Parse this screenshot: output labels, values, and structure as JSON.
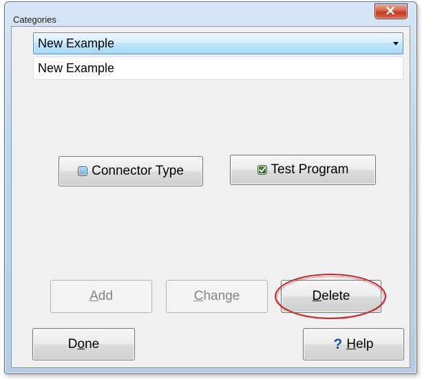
{
  "window": {
    "title": "Categories"
  },
  "category_select": {
    "value": "New Example"
  },
  "name_field": {
    "value": "New Example"
  },
  "options": [
    {
      "label": "Connector Type",
      "checked": false
    },
    {
      "label": "Test Program",
      "checked": true
    }
  ],
  "buttons": {
    "add": {
      "mnemonic": "A",
      "rest": "dd",
      "enabled": false
    },
    "change": {
      "mnemonic": "C",
      "rest": "hange",
      "enabled": false
    },
    "delete": {
      "mnemonic": "D",
      "rest": "elete",
      "enabled": true
    },
    "done": {
      "before": "D",
      "mnemonic": "o",
      "rest": "ne",
      "enabled": true
    },
    "help": {
      "mnemonic": "H",
      "rest": "elp",
      "icon": "question-mark",
      "enabled": true
    }
  },
  "colors": {
    "highlight_ellipse": "#c8252a",
    "help_icon": "#1b4fb0",
    "check_green": "#2f5d22"
  }
}
